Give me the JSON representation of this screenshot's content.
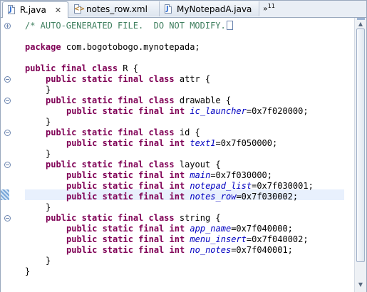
{
  "tabs": [
    {
      "label": "R.java",
      "icon": "java-file-icon",
      "active": true
    },
    {
      "label": "notes_row.xml",
      "icon": "xml-file-icon",
      "active": false
    },
    {
      "label": "MyNotepadA.java",
      "icon": "java-file-icon",
      "active": false
    }
  ],
  "overflow": {
    "symbol": "»",
    "count": "11"
  },
  "code": {
    "comment": "/* AUTO-GENERATED FILE.  DO NOT MODIFY.",
    "pkg_kw": "package",
    "pkg_name": " com.bogotobogo.mynotepada;",
    "class_kw": "public final class",
    "class_name": " R {",
    "inner_kw": "public static final class",
    "field_kw": "public static final int",
    "attr_name": " attr {",
    "drawable_name": " drawable {",
    "id_name": " id {",
    "layout_name": " layout {",
    "string_name": " string {",
    "close_brace": "}",
    "fields": {
      "ic_launcher": {
        "name": "ic_launcher",
        "value": "=0x7f020000;"
      },
      "text1": {
        "name": "text1",
        "value": "=0x7f050000;"
      },
      "main": {
        "name": "main",
        "value": "=0x7f030000;"
      },
      "notepad_list": {
        "name": "notepad_list",
        "value": "=0x7f030001;"
      },
      "notes_row": {
        "name": "notes_row",
        "value": "=0x7f030002;"
      },
      "app_name": {
        "name": "app_name",
        "value": "=0x7f040000;"
      },
      "menu_insert": {
        "name": "menu_insert",
        "value": "=0x7f040002;"
      },
      "no_notes": {
        "name": "no_notes",
        "value": "=0x7f040001;"
      }
    }
  },
  "colors": {
    "keyword": "#7f0055",
    "comment": "#3f7f5f",
    "field": "#0000c0",
    "current_line": "#e8f0fd"
  }
}
